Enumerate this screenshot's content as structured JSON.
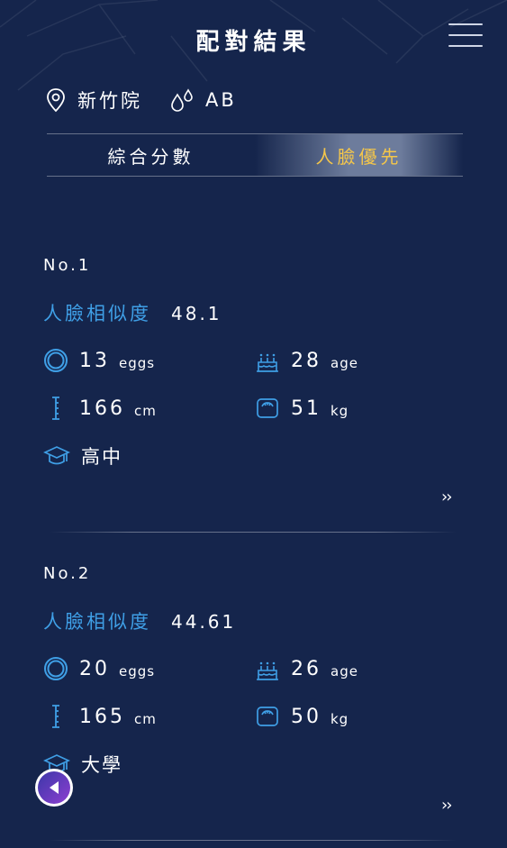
{
  "header": {
    "title": "配對結果",
    "menu_icon": "hamburger-menu-icon"
  },
  "info": {
    "location": "新竹院",
    "blood_type": "AB",
    "location_icon": "map-pin-icon",
    "blood_icon": "blood-drops-icon"
  },
  "tabs": [
    {
      "label": "綜合分數",
      "active": false
    },
    {
      "label": "人臉優先",
      "active": true
    }
  ],
  "results": [
    {
      "no": "No.1",
      "similarity_label": "人臉相似度",
      "similarity": "48.1",
      "eggs": "13",
      "eggs_unit": "eggs",
      "age": "28",
      "age_unit": "age",
      "height": "166",
      "height_unit": "cm",
      "weight": "51",
      "weight_unit": "kg",
      "education": "高中",
      "more": "››"
    },
    {
      "no": "No.2",
      "similarity_label": "人臉相似度",
      "similarity": "44.61",
      "eggs": "20",
      "eggs_unit": "eggs",
      "age": "26",
      "age_unit": "age",
      "height": "165",
      "height_unit": "cm",
      "weight": "50",
      "weight_unit": "kg",
      "education": "大學",
      "more": "››"
    }
  ],
  "colors": {
    "background": "#15254c",
    "accent_blue": "#3f9fe6",
    "accent_gold": "#f4c64a"
  }
}
